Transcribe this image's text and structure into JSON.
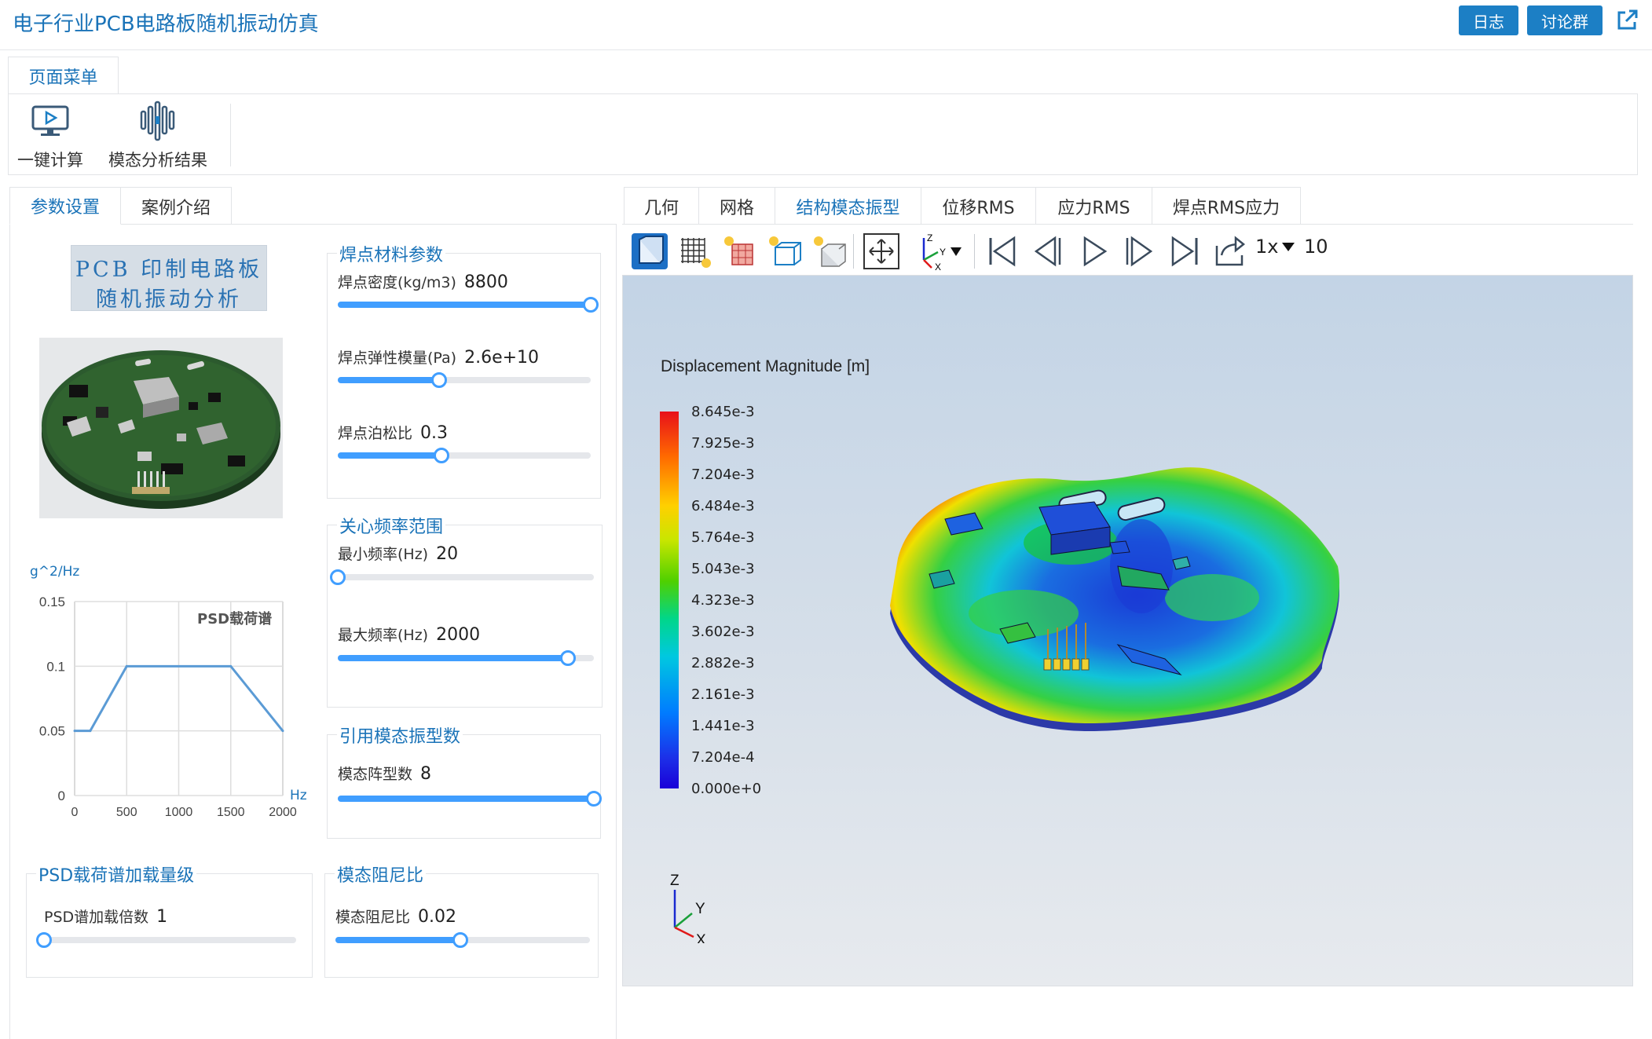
{
  "header": {
    "title": "电子行业PCB电路板随机振动仿真",
    "log_button": "日志",
    "discuss_button": "讨论群",
    "external_icon": "external-link-icon"
  },
  "page_menu": {
    "tab_label": "页面菜单",
    "tools": [
      {
        "label": "一键计算",
        "icon": "monitor-play-icon"
      },
      {
        "label": "模态分析结果",
        "icon": "waveform-bars-icon"
      }
    ]
  },
  "left_tabs": [
    "参数设置",
    "案例介绍"
  ],
  "case_image": {
    "title_line1": "PCB 印制电路板",
    "title_line2": "随机振动分析"
  },
  "psd_chart": {
    "ylabel_unit": "g^2/Hz",
    "xlabel_unit": "Hz",
    "caption": "PSD载荷谱"
  },
  "chart_data": {
    "type": "line",
    "title": "PSD载荷谱",
    "xlabel": "Hz",
    "ylabel": "g^2/Hz",
    "x": [
      0,
      150,
      500,
      1500,
      2000
    ],
    "series": [
      {
        "values": [
          0.05,
          0.05,
          0.1,
          0.1,
          0.05
        ]
      }
    ],
    "xlim": [
      0,
      2000
    ],
    "ylim": [
      0,
      0.15
    ],
    "xticks": [
      "0",
      "500",
      "1000",
      "1500",
      "2000"
    ],
    "yticks": [
      "0",
      "0.05",
      "0.1",
      "0.15"
    ],
    "grid": true
  },
  "groups": {
    "solder_material": {
      "title": "焊点材料参数",
      "params": [
        {
          "label": "焊点密度(kg/m3)",
          "value": "8800",
          "fraction": 1.0
        },
        {
          "label": "焊点弹性模量(Pa)",
          "value": "2.6e+10",
          "fraction": 0.4
        },
        {
          "label": "焊点泊松比",
          "value": "0.3",
          "fraction": 0.41
        }
      ]
    },
    "freq_range": {
      "title": "关心频率范围",
      "params": [
        {
          "label": "最小频率(Hz)",
          "value": "20",
          "fraction": 0.0
        },
        {
          "label": "最大频率(Hz)",
          "value": "2000",
          "fraction": 0.9
        }
      ]
    },
    "modes": {
      "title": "引用模态振型数",
      "params": [
        {
          "label": "模态阵型数",
          "value": "8",
          "fraction": 1.0
        }
      ]
    },
    "psd_level": {
      "title": "PSD载荷谱加载量级",
      "params": [
        {
          "label": "PSD谱加载倍数",
          "value": "1",
          "fraction": 0.0
        }
      ]
    },
    "damping": {
      "title": "模态阻尼比",
      "params": [
        {
          "label": "模态阻尼比",
          "value": "0.02",
          "fraction": 0.49
        }
      ]
    }
  },
  "right_tabs": [
    "几何",
    "网格",
    "结构模态振型",
    "位移RMS",
    "应力RMS",
    "焊点RMS应力"
  ],
  "active_right_tab": "结构模态振型",
  "toolbar": {
    "icons": [
      "solid-view-icon",
      "mesh-view-icon",
      "mesh-light-icon",
      "wireframe-light-icon",
      "solid-light-icon",
      "fit-view-icon",
      "axes-orient-icon",
      "first-frame-icon",
      "prev-frame-icon",
      "play-icon",
      "next-frame-icon",
      "last-frame-icon",
      "loop-icon"
    ],
    "speed_label": "1x",
    "frame_count": "10"
  },
  "colorbar": {
    "title": "Displacement Magnitude [m]",
    "labels": [
      "8.645e-3",
      "7.925e-3",
      "7.204e-3",
      "6.484e-3",
      "5.764e-3",
      "5.043e-3",
      "4.323e-3",
      "3.602e-3",
      "2.882e-3",
      "2.161e-3",
      "1.441e-3",
      "7.204e-4",
      "0.000e+0"
    ]
  },
  "axes_triad": {
    "z": "Z",
    "y": "Y",
    "x": "X"
  },
  "colors": {
    "accent": "#1a73b8",
    "button": "#1c7fc5",
    "slider": "#409eff"
  }
}
